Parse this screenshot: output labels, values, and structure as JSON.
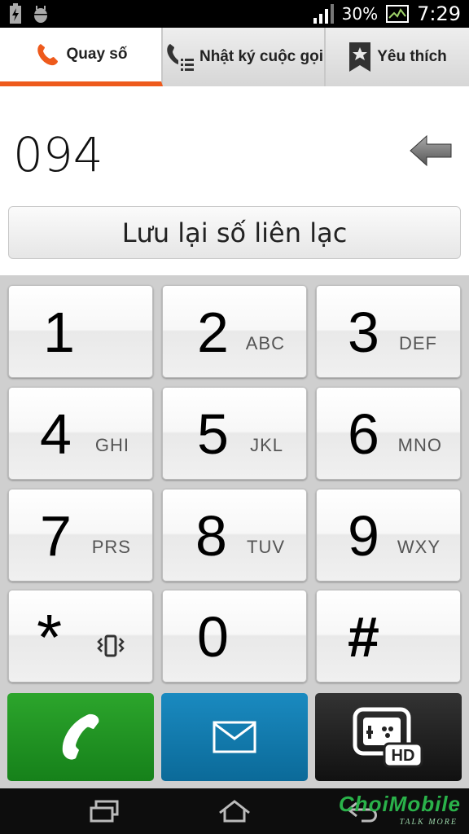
{
  "status_bar": {
    "battery_percent": "30%",
    "time": "7:29",
    "icons": [
      "charging-icon",
      "android-debug-icon",
      "signal-icon",
      "battery-icon",
      "gallery-icon"
    ]
  },
  "tabs": [
    {
      "label": "Quay số",
      "icon": "phone-icon",
      "active": true
    },
    {
      "label": "Nhật ký cuộc gọi",
      "icon": "call-log-icon",
      "active": false
    },
    {
      "label": "Yêu thích",
      "icon": "favorite-star-icon",
      "active": false
    }
  ],
  "dialed_number": "094",
  "save_contact_label": "Lưu lại số liên lạc",
  "keys": [
    {
      "digit": "1",
      "letters": ""
    },
    {
      "digit": "2",
      "letters": "ABC"
    },
    {
      "digit": "3",
      "letters": "DEF"
    },
    {
      "digit": "4",
      "letters": "GHI"
    },
    {
      "digit": "5",
      "letters": "JKL"
    },
    {
      "digit": "6",
      "letters": "MNO"
    },
    {
      "digit": "7",
      "letters": "PRS"
    },
    {
      "digit": "8",
      "letters": "TUV"
    },
    {
      "digit": "9",
      "letters": "WXY"
    },
    {
      "digit": "*",
      "letters": ""
    },
    {
      "digit": "0",
      "letters": ""
    },
    {
      "digit": "#",
      "letters": ""
    }
  ],
  "actions": {
    "call_color": "#1f9a24",
    "message_color": "#0f78ab",
    "video_color": "#1c1c1c",
    "video_badge": "HD"
  },
  "colors": {
    "accent": "#ee5a1c"
  },
  "watermark": {
    "brand": "ChoiMobile",
    "tagline": "TALK MORE"
  }
}
